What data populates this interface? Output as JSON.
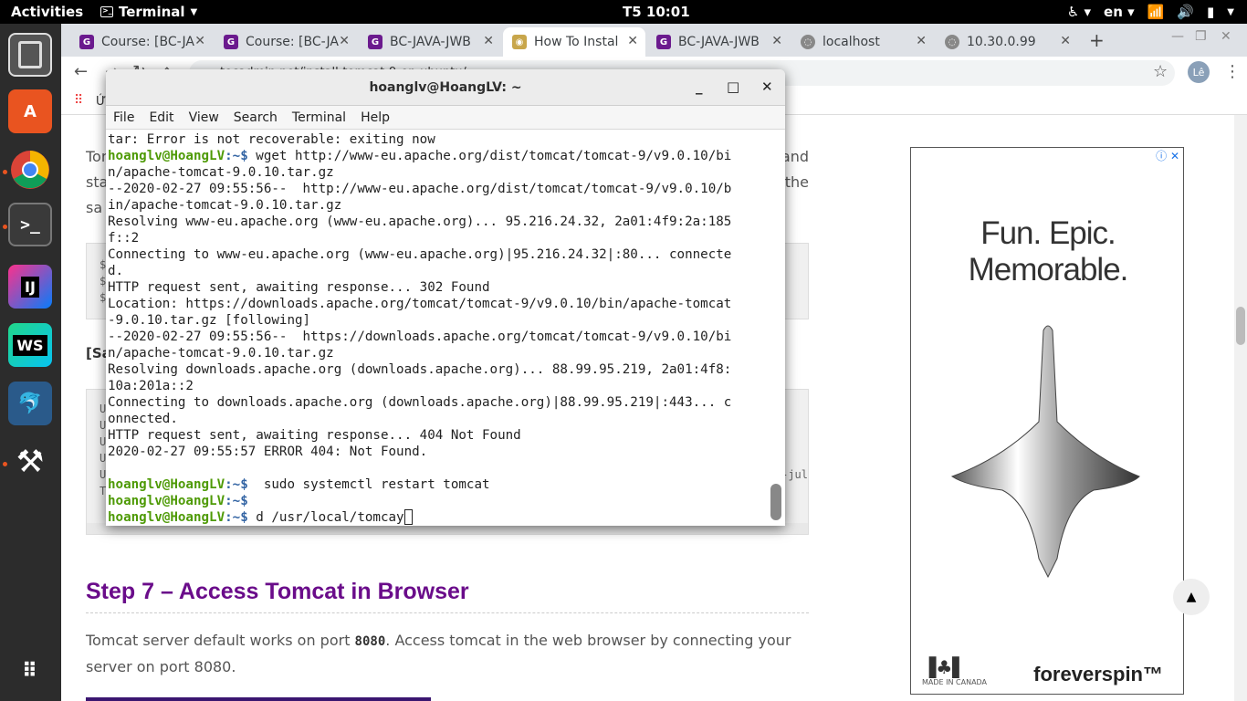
{
  "topbar": {
    "activities": "Activities",
    "app_name": "Terminal",
    "clock": "T5 10:01",
    "lang": "en"
  },
  "dock": {
    "items": [
      "files-icon",
      "app-store-icon",
      "chrome-icon",
      "terminal-icon",
      "intellij-icon",
      "webstorm-icon",
      "mysql-workbench-icon",
      "system-tools-icon",
      "show-apps-icon"
    ],
    "labels": {
      "intellij": "IJ",
      "webstorm": "WS"
    }
  },
  "browser": {
    "tabs": [
      {
        "label": "Course: [BC-JA",
        "fav_color": "#6b1a8e"
      },
      {
        "label": "Course: [BC-JA",
        "fav_color": "#6b1a8e"
      },
      {
        "label": "BC-JAVA-JWB",
        "fav_color": "#6b1a8e"
      },
      {
        "label": "How To Instal",
        "fav_color": "#c8a64b"
      },
      {
        "label": "BC-JAVA-JWB",
        "fav_color": "#6b1a8e"
      },
      {
        "label": "localhost",
        "fav_color": "#888888"
      },
      {
        "label": "10.30.0.99",
        "fav_color": "#888888"
      }
    ],
    "url": "tecadmin.net/install-tomcat-9-on-ubuntu/",
    "bookmark_label": "Ứ",
    "profile": "Lê"
  },
  "page": {
    "p1_lines": [
      "Tom",
      "sta",
      "sa"
    ],
    "p1_right": [
      "and",
      "the"
    ],
    "code1": [
      "$",
      "$",
      "$"
    ],
    "sample_label": "[Sa",
    "code2": [
      "U",
      "U",
      "U",
      "U",
      "U",
      "T"
    ],
    "code2_right": "-jul",
    "step_title": "Step 7 – Access Tomcat in Browser",
    "p2": "Tomcat server default works on port ",
    "p2_bold": "8080",
    "p2_rest": ". Access tomcat in the web browser by connecting your server on port 8080."
  },
  "ad": {
    "headline1": "Fun. Epic.",
    "headline2": "Memorable.",
    "brand": "foreverspin™",
    "made": "MADE IN CANADA"
  },
  "terminal": {
    "title": "hoanglv@HoangLV: ~",
    "menu": [
      "File",
      "Edit",
      "View",
      "Search",
      "Terminal",
      "Help"
    ],
    "prompt_user": "hoanglv@HoangLV",
    "prompt_path": ":~$",
    "out1": "tar: Error is not recoverable: exiting now",
    "cmd1": " wget http://www-eu.apache.org/dist/tomcat/tomcat-9/v9.0.10/bi",
    "out2": "n/apache-tomcat-9.0.10.tar.gz\n--2020-02-27 09:55:56--  http://www-eu.apache.org/dist/tomcat/tomcat-9/v9.0.10/b\nin/apache-tomcat-9.0.10.tar.gz\nResolving www-eu.apache.org (www-eu.apache.org)... 95.216.24.32, 2a01:4f9:2a:185\nf::2\nConnecting to www-eu.apache.org (www-eu.apache.org)|95.216.24.32|:80... connecte\nd.\nHTTP request sent, awaiting response... 302 Found\nLocation: https://downloads.apache.org/tomcat/tomcat-9/v9.0.10/bin/apache-tomcat\n-9.0.10.tar.gz [following]\n--2020-02-27 09:55:56--  https://downloads.apache.org/tomcat/tomcat-9/v9.0.10/bi\nn/apache-tomcat-9.0.10.tar.gz\nResolving downloads.apache.org (downloads.apache.org)... 88.99.95.219, 2a01:4f8:\n10a:201a::2\nConnecting to downloads.apache.org (downloads.apache.org)|88.99.95.219|:443... c\nonnected.\nHTTP request sent, awaiting response... 404 Not Found\n2020-02-27 09:55:57 ERROR 404: Not Found.\n",
    "cmd2": "  sudo systemctl restart tomcat",
    "cmd3": "",
    "cmd4": " d /usr/local/tomcay"
  }
}
